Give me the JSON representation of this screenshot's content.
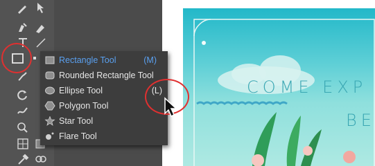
{
  "flyout_menu": {
    "items": [
      {
        "label": "Rectangle Tool",
        "shortcut": "(M)"
      },
      {
        "label": "Rounded Rectangle Tool",
        "shortcut": ""
      },
      {
        "label": "Ellipse Tool",
        "shortcut": "(L)"
      },
      {
        "label": "Polygon Tool",
        "shortcut": ""
      },
      {
        "label": "Star Tool",
        "shortcut": ""
      },
      {
        "label": "Flare Tool",
        "shortcut": ""
      }
    ]
  },
  "artwork": {
    "line1": "COME EXP",
    "line2": "BE"
  },
  "colors": {
    "selected_text": "#5aa0f0",
    "callout": "#e03030",
    "toolbar_bg": "#535353",
    "menu_bg": "#3d3d3d"
  },
  "icons": [
    "pen-icon",
    "curvature-icon",
    "type-icon",
    "rectangle-icon",
    "paintbrush-icon",
    "rotate-icon",
    "warp-icon",
    "shape-builder-icon",
    "perspective-grid-icon",
    "eyedropper-icon",
    "blend-icon",
    "cursor-icon"
  ]
}
